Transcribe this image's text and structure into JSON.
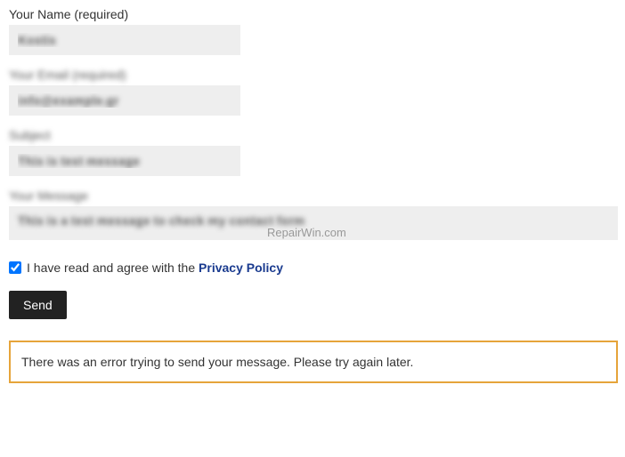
{
  "form": {
    "name_label": "Your Name (required)",
    "name_value": "Kostis",
    "email_label": "Your Email (required)",
    "email_value": "info@example.gr",
    "subject_label": "Subject",
    "subject_value": "This is test message",
    "message_label": "Your Message",
    "message_value": "This is a test message to check my contact form"
  },
  "consent": {
    "checked": true,
    "text_prefix": "I have read and agree with the ",
    "link_text": "Privacy Policy"
  },
  "button": {
    "send": "Send"
  },
  "error": {
    "message": "There was an error trying to send your message. Please try again later."
  },
  "watermark": "RepairWin.com"
}
